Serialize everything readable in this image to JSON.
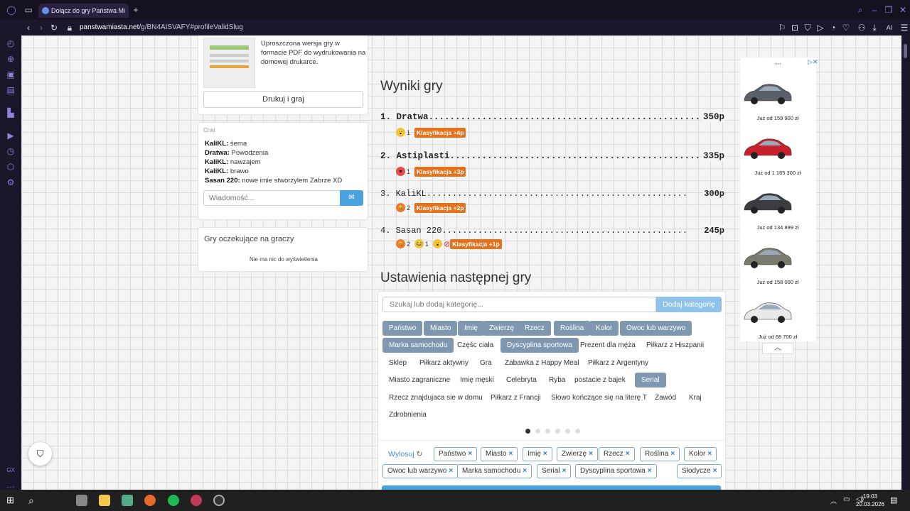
{
  "browser": {
    "tab_title": "Dołącz do gry Państwa Mi",
    "url_host": "panstwamiasta.net",
    "url_path": "/g/BN4AISVAFY#profileValidSlug",
    "ai_label": "AI"
  },
  "left": {
    "print_desc": "Uproszczona wersja gry w formacie PDF do wydrukowania na domowej drukarce.",
    "print_button": "Drukuj i graj",
    "chat_title": "Chat",
    "chat": [
      {
        "user": "KaliKL:",
        "text": "śema"
      },
      {
        "user": "Dratwa:",
        "text": "Powodzenia"
      },
      {
        "user": "KaliKL:",
        "text": "nawzajem"
      },
      {
        "user": "KaliKL:",
        "text": "brawo"
      },
      {
        "user": "Sasan 220:",
        "text": "nowe imie stworzylem Zabrze XD"
      }
    ],
    "chat_placeholder": "Wiadomość...",
    "waiting_title": "Gry oczekujące na graczy",
    "waiting_empty": "Nie ma nic do wyświetlenia"
  },
  "results": {
    "title": "Wyniki gry",
    "rows": [
      {
        "line": "1. Dratwa...................................................",
        "points": "350p",
        "reactions": "1",
        "badge": "Klasyfikacja +4p"
      },
      {
        "line": "2. Astiplasti...............................................",
        "points": "335p",
        "reactions": "1",
        "badge": "Klasyfikacja +3p"
      },
      {
        "line": "3. KaliKL...................................................",
        "points": "300p",
        "reactions": "2",
        "badge": "Klasyfikacja +2p"
      },
      {
        "line": "4. Sasan 220................................................",
        "points": "245p",
        "r1": "2",
        "r2": "1",
        "badge": "Klasyfikacja +1p"
      }
    ]
  },
  "settings": {
    "title": "Ustawienia następnej gry",
    "search_placeholder": "Szukaj lub dodaj kategorię...",
    "add_button": "Dodaj kategorię",
    "random_label": "Wylosuj"
  },
  "categories": [
    "Państwo",
    "Miasto",
    "Imię",
    "Zwierzę",
    "Rzecz",
    "Roślina",
    "Kolor",
    "Owoc lub warzywo",
    "Marka samochodu",
    "Częśc ciała",
    "Dyscyplina sportowa",
    "Prezent dla męża",
    "Piłkarz z Hiszpanii",
    "Sklep",
    "Piłkarz aktywny",
    "Gra",
    "Zabawka z Happy Meal",
    "Piłkarz z Argentyny",
    "Miasto zagraniczne",
    "Imię męski",
    "Celebryta",
    "Ryba",
    "postacie z bajek",
    "Serial",
    "Rzecz znajdujaca sie w domu",
    "Piłkarz z Francji",
    "Słowo kończące się na literę T",
    "Zawód",
    "Kraj",
    "Zdrobnienia"
  ],
  "selected": [
    "Państwo",
    "Miasto",
    "Imię",
    "Zwierzę",
    "Rzecz",
    "Roślina",
    "Kolor",
    "Owoc lub warzywo",
    "Marka samochodu",
    "Serial",
    "Dyscyplina sportowa",
    "Słodycze"
  ],
  "ad": {
    "prices": [
      "Już od 159 900 zł",
      "Już od 1 165 300 zł",
      "Już od 134 899 zł",
      "Już od 158 000 zł",
      "Już od 68 700 zł"
    ]
  },
  "taskbar": {
    "time": "19:03",
    "date": "20.03.2026"
  },
  "colors": {
    "accent": "#7f98b0",
    "badge": "#e5731e",
    "button": "#4aa3df"
  }
}
